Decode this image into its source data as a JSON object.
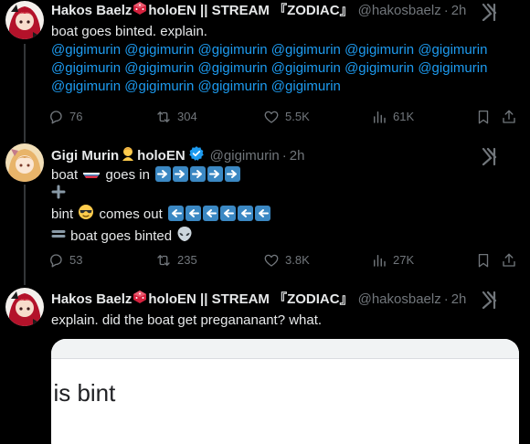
{
  "tweets": [
    {
      "display_name": "Hakos Baelz",
      "display_suffix": "holoEN || STREAM 『ZODIAC』",
      "handle": "@hakosbaelz",
      "time": "2h",
      "text_line1": "boat goes binted. explain.",
      "mentions": [
        [
          "@gigimurin",
          "@gigimurin",
          "@gigimurin",
          "@gigimurin",
          "@gigimurin",
          "@gigimurin"
        ],
        [
          "@gigimurin",
          "@gigimurin",
          "@gigimurin",
          "@gigimurin",
          "@gigimurin",
          "@gigimurin"
        ],
        [
          "@gigimurin",
          "@gigimurin",
          "@gigimurin",
          "@gigimurin"
        ]
      ],
      "stats": {
        "replies": "76",
        "reposts": "304",
        "likes": "5.5K",
        "views": "61K"
      }
    },
    {
      "display_name": "Gigi Murin",
      "display_suffix": "holoEN",
      "handle": "@gigimurin",
      "time": "2h",
      "line1_a": "boat",
      "line1_b": "goes in",
      "line3_a": "bint",
      "line3_b": "comes out",
      "line4": "boat goes binted",
      "stats": {
        "replies": "53",
        "reposts": "235",
        "likes": "3.8K",
        "views": "27K"
      }
    },
    {
      "display_name": "Hakos Baelz",
      "display_suffix": "holoEN || STREAM 『ZODIAC』",
      "handle": "@hakosbaelz",
      "time": "2h",
      "text_line1": "explain. did the boat get pregananant? what.",
      "card_text": "t is bint"
    }
  ],
  "colors": {
    "accent": "#1d9bf0",
    "muted": "#71767b",
    "text": "#e7e9ea",
    "background": "#000000"
  },
  "icons": [
    "reply-icon",
    "repost-icon",
    "like-icon",
    "views-icon",
    "bookmark-icon",
    "share-icon",
    "grok-icon",
    "verified-icon"
  ]
}
